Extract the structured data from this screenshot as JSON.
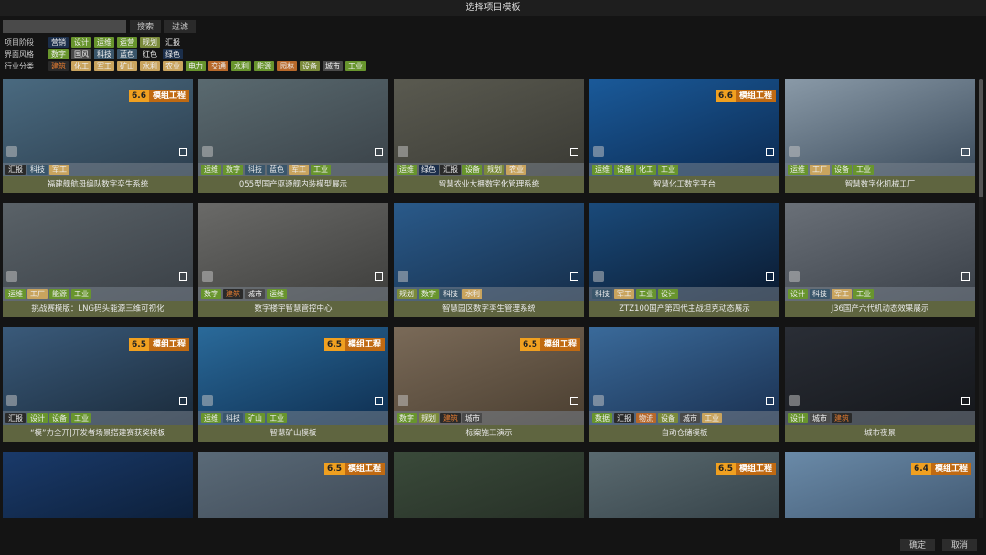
{
  "title": "选择项目模板",
  "search": {
    "placeholder": "",
    "search_label": "搜索",
    "filter_label": "过滤"
  },
  "filters": [
    {
      "label": "项目阶段",
      "tags": [
        {
          "t": "营销",
          "c": "navy"
        },
        {
          "t": "设计",
          "c": "green"
        },
        {
          "t": "运维",
          "c": "green"
        },
        {
          "t": "运营",
          "c": "green"
        },
        {
          "t": "规划",
          "c": "olive"
        },
        {
          "t": "汇报",
          "c": "plain"
        }
      ]
    },
    {
      "label": "界面风格",
      "tags": [
        {
          "t": "数字",
          "c": "green"
        },
        {
          "t": "国风",
          "c": "gray"
        },
        {
          "t": "科技",
          "c": "steel"
        },
        {
          "t": "蓝色",
          "c": "steel"
        },
        {
          "t": "红色",
          "c": "plain"
        },
        {
          "t": "绿色",
          "c": "navy"
        }
      ]
    },
    {
      "label": "行业分类",
      "tags": [
        {
          "t": "建筑",
          "c": "bld"
        },
        {
          "t": "化工",
          "c": "tan"
        },
        {
          "t": "军工",
          "c": "tan"
        },
        {
          "t": "矿山",
          "c": "tan"
        },
        {
          "t": "水利",
          "c": "tan"
        },
        {
          "t": "农业",
          "c": "tan"
        },
        {
          "t": "电力",
          "c": "green"
        },
        {
          "t": "交通",
          "c": "orange"
        },
        {
          "t": "水利",
          "c": "green"
        },
        {
          "t": "能源",
          "c": "green"
        },
        {
          "t": "园林",
          "c": "orange"
        },
        {
          "t": "设备",
          "c": "olive"
        },
        {
          "t": "城市",
          "c": "gray"
        },
        {
          "t": "工业",
          "c": "green"
        }
      ]
    }
  ],
  "cards": [
    {
      "title": "福建舰航母编队数字孪生系统",
      "badge": "6.6",
      "badge_text": "模组工程",
      "img": [
        "#4a6a80",
        "#2c3e4e"
      ],
      "tags": [
        {
          "t": "汇报",
          "c": "dark"
        },
        {
          "t": "科技",
          "c": "steel"
        },
        {
          "t": "军工",
          "c": "tan"
        }
      ]
    },
    {
      "title": "055型国产驱逐舰内装模型展示",
      "img": [
        "#5a6a70",
        "#3a4248"
      ],
      "tags": [
        {
          "t": "运维",
          "c": "green"
        },
        {
          "t": "数字",
          "c": "green"
        },
        {
          "t": "科技",
          "c": "steel"
        },
        {
          "t": "蓝色",
          "c": "steel"
        },
        {
          "t": "军工",
          "c": "tan"
        },
        {
          "t": "工业",
          "c": "green"
        }
      ]
    },
    {
      "title": "智慧农业大棚数字化管理系统",
      "img": [
        "#5a5a50",
        "#3a3a34"
      ],
      "tags": [
        {
          "t": "运维",
          "c": "green"
        },
        {
          "t": "绿色",
          "c": "navy"
        },
        {
          "t": "汇报",
          "c": "dark"
        },
        {
          "t": "设备",
          "c": "green"
        },
        {
          "t": "规划",
          "c": "olive"
        },
        {
          "t": "农业",
          "c": "tan"
        }
      ]
    },
    {
      "title": "智慧化工数字平台",
      "badge": "6.6",
      "badge_text": "模组工程",
      "img": [
        "#1a5a9a",
        "#0c2a50"
      ],
      "tags": [
        {
          "t": "运维",
          "c": "green"
        },
        {
          "t": "设备",
          "c": "green"
        },
        {
          "t": "化工",
          "c": "green"
        },
        {
          "t": "工业",
          "c": "green"
        }
      ]
    },
    {
      "title": "智慧数字化机械工厂",
      "img": [
        "#8a9aa8",
        "#3a4a5a"
      ],
      "tags": [
        {
          "t": "运维",
          "c": "green"
        },
        {
          "t": "工厂",
          "c": "tan"
        },
        {
          "t": "设备",
          "c": "green"
        },
        {
          "t": "工业",
          "c": "green"
        }
      ]
    },
    {
      "title": "挑战赛模版：LNG码头能源三维可视化",
      "img": [
        "#5a6268",
        "#3a4046"
      ],
      "tags": [
        {
          "t": "运维",
          "c": "green"
        },
        {
          "t": "工厂",
          "c": "tan"
        },
        {
          "t": "能源",
          "c": "green"
        },
        {
          "t": "工业",
          "c": "green"
        }
      ]
    },
    {
      "title": "数字楼宇智慧管控中心",
      "img": [
        "#6a6a68",
        "#3e3e3c"
      ],
      "tags": [
        {
          "t": "数字",
          "c": "green"
        },
        {
          "t": "建筑",
          "c": "bld"
        },
        {
          "t": "城市",
          "c": "gray"
        },
        {
          "t": "运维",
          "c": "green"
        }
      ]
    },
    {
      "title": "智慧园区数字孪生管理系统",
      "img": [
        "#2a5a8a",
        "#162e4a"
      ],
      "tags": [
        {
          "t": "规划",
          "c": "olive"
        },
        {
          "t": "数字",
          "c": "green"
        },
        {
          "t": "科技",
          "c": "steel"
        },
        {
          "t": "水利",
          "c": "tan"
        }
      ]
    },
    {
      "title": "ZTZ100国产第四代主战坦克动态展示",
      "img": [
        "#1a4a7a",
        "#0a1a30"
      ],
      "tags": [
        {
          "t": "科技",
          "c": "steel"
        },
        {
          "t": "军工",
          "c": "tan"
        },
        {
          "t": "工业",
          "c": "green"
        },
        {
          "t": "设计",
          "c": "green"
        }
      ]
    },
    {
      "title": "J36国产六代机动态效果展示",
      "img": [
        "#6a7078",
        "#3a4048"
      ],
      "tags": [
        {
          "t": "设计",
          "c": "green"
        },
        {
          "t": "科技",
          "c": "steel"
        },
        {
          "t": "军工",
          "c": "tan"
        },
        {
          "t": "工业",
          "c": "green"
        }
      ]
    },
    {
      "title": "“模”力全开|开发者场景搭建赛获奖模板",
      "badge": "6.5",
      "badge_text": "模组工程",
      "img": [
        "#3a5a7a",
        "#1a2a3a"
      ],
      "tags": [
        {
          "t": "汇报",
          "c": "dark"
        },
        {
          "t": "设计",
          "c": "green"
        },
        {
          "t": "设备",
          "c": "green"
        },
        {
          "t": "工业",
          "c": "green"
        }
      ]
    },
    {
      "title": "智慧矿山模板",
      "badge": "6.5",
      "badge_text": "模组工程",
      "img": [
        "#2a6a9a",
        "#0e2e50"
      ],
      "tags": [
        {
          "t": "运维",
          "c": "green"
        },
        {
          "t": "科技",
          "c": "steel"
        },
        {
          "t": "矿山",
          "c": "green"
        },
        {
          "t": "工业",
          "c": "green"
        }
      ]
    },
    {
      "title": "标案施工演示",
      "badge": "6.5",
      "badge_text": "模组工程",
      "img": [
        "#7a6a58",
        "#4a3e30"
      ],
      "tags": [
        {
          "t": "数字",
          "c": "green"
        },
        {
          "t": "规划",
          "c": "olive"
        },
        {
          "t": "建筑",
          "c": "bld"
        },
        {
          "t": "城市",
          "c": "gray"
        }
      ]
    },
    {
      "title": "自动仓储模板",
      "img": [
        "#3a6a9a",
        "#1a3050"
      ],
      "tags": [
        {
          "t": "数据",
          "c": "green"
        },
        {
          "t": "汇报",
          "c": "dark"
        },
        {
          "t": "物流",
          "c": "orange"
        },
        {
          "t": "设备",
          "c": "olive"
        },
        {
          "t": "城市",
          "c": "gray"
        },
        {
          "t": "工业",
          "c": "tan"
        }
      ]
    },
    {
      "title": "城市夜景",
      "img": [
        "#2a2e36",
        "#14161a"
      ],
      "tags": [
        {
          "t": "设计",
          "c": "green"
        },
        {
          "t": "城市",
          "c": "gray"
        },
        {
          "t": "建筑",
          "c": "bld"
        }
      ]
    },
    {
      "title": "",
      "img": [
        "#1a3a6a",
        "#0a1a30"
      ],
      "tags": []
    },
    {
      "title": "",
      "badge": "6.5",
      "badge_text": "模组工程",
      "img": [
        "#5a6a78",
        "#3a4450"
      ],
      "tags": []
    },
    {
      "title": "",
      "img": [
        "#3a4a3a",
        "#222a22"
      ],
      "tags": []
    },
    {
      "title": "",
      "badge": "6.5",
      "badge_text": "模组工程",
      "img": [
        "#5a6a70",
        "#2e3a40"
      ],
      "tags": []
    },
    {
      "title": "",
      "badge": "6.4",
      "badge_text": "模组工程",
      "img": [
        "#6a8aa8",
        "#3a5068"
      ],
      "tags": []
    }
  ],
  "footer": {
    "ok": "确定",
    "cancel": "取消"
  }
}
